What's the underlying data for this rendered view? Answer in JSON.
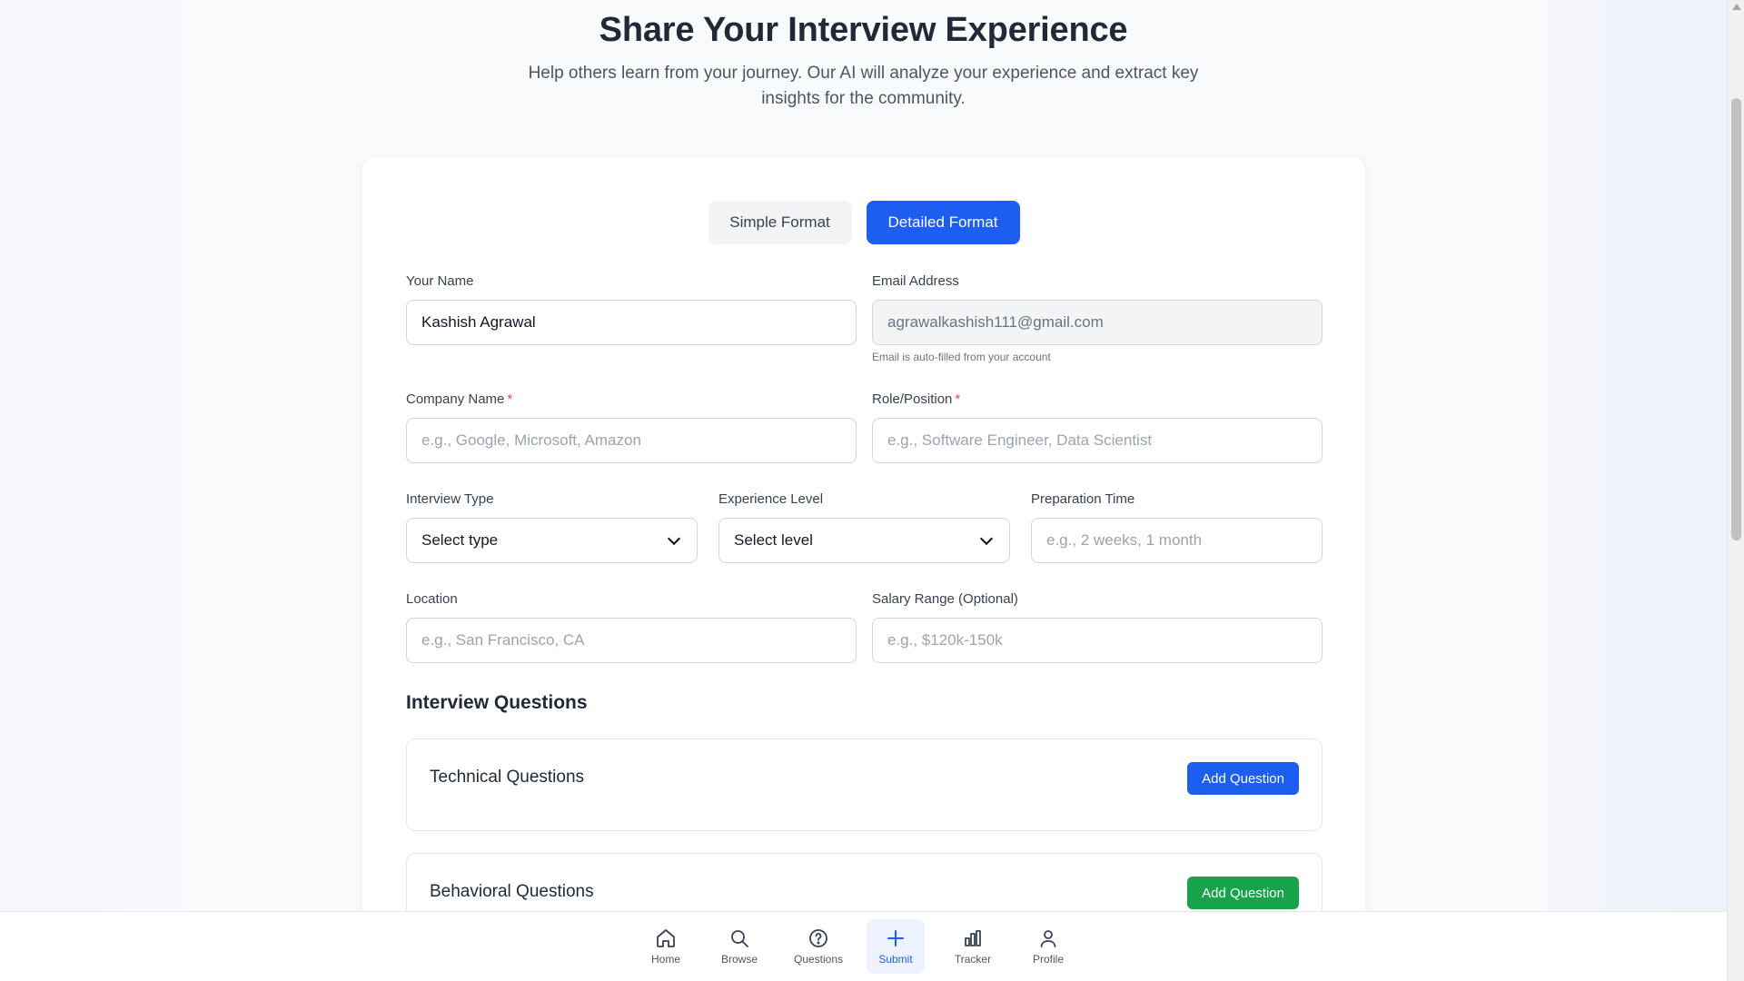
{
  "header": {
    "title": "Share Your Interview Experience",
    "subtitle": "Help others learn from your journey. Our AI will analyze your experience and extract key insights for the community."
  },
  "format_toggle": {
    "simple_label": "Simple Format",
    "detailed_label": "Detailed Format",
    "selected": "Detailed Format"
  },
  "form": {
    "name": {
      "label": "Your Name",
      "value": "Kashish Agrawal"
    },
    "email": {
      "label": "Email Address",
      "value": "agrawalkashish111@gmail.com",
      "hint": "Email is auto-filled from your account"
    },
    "company": {
      "label": "Company Name",
      "required": "*",
      "placeholder": "e.g., Google, Microsoft, Amazon"
    },
    "role": {
      "label": "Role/Position",
      "required": "*",
      "placeholder": "e.g., Software Engineer, Data Scientist"
    },
    "interview_type": {
      "label": "Interview Type",
      "value": "Select type"
    },
    "experience_level": {
      "label": "Experience Level",
      "value": "Select level"
    },
    "prep_time": {
      "label": "Preparation Time",
      "placeholder": "e.g., 2 weeks, 1 month"
    },
    "location": {
      "label": "Location",
      "placeholder": "e.g., San Francisco, CA"
    },
    "salary": {
      "label": "Salary Range (Optional)",
      "placeholder": "e.g., $120k-150k"
    }
  },
  "questions": {
    "section_title": "Interview Questions",
    "technical": {
      "title": "Technical Questions",
      "button": "Add Question"
    },
    "behavioral": {
      "title": "Behavioral Questions",
      "button": "Add Question"
    }
  },
  "bottom_nav": {
    "items": [
      {
        "label": "Home",
        "icon": "home-icon"
      },
      {
        "label": "Browse",
        "icon": "search-icon"
      },
      {
        "label": "Questions",
        "icon": "help-circle-icon"
      },
      {
        "label": "Submit",
        "icon": "plus-icon",
        "active": true
      },
      {
        "label": "Tracker",
        "icon": "bar-chart-icon"
      },
      {
        "label": "Profile",
        "icon": "user-icon"
      }
    ]
  },
  "colors": {
    "primary": "#1d5ef0",
    "success": "#16a34a",
    "required": "#ef4444"
  }
}
